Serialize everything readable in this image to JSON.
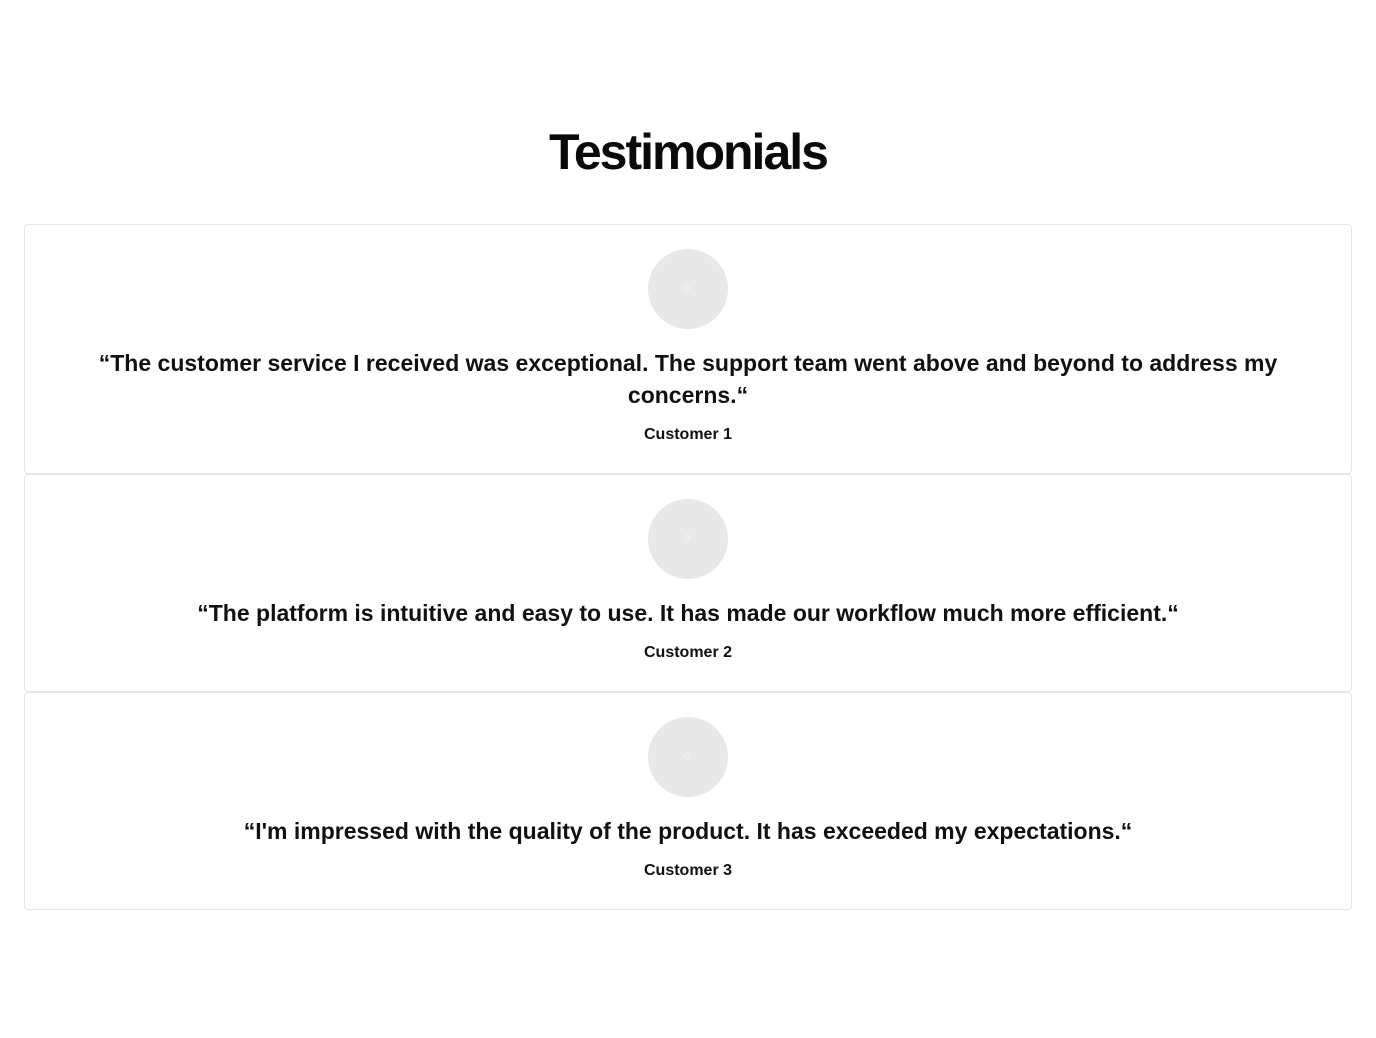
{
  "section": {
    "title": "Testimonials"
  },
  "testimonials": [
    {
      "quote": "“The customer service I received was exceptional. The support team went above and beyond to address my concerns.“",
      "author": "Customer 1"
    },
    {
      "quote": "“The platform is intuitive and easy to use. It has made our workflow much more efficient.“",
      "author": "Customer 2"
    },
    {
      "quote": "“I'm impressed with the quality of the product. It has exceeded my expectations.“",
      "author": "Customer 3"
    }
  ],
  "colors": {
    "background": "#ffffff",
    "text": "#111111",
    "card_border": "#e6e6e6",
    "avatar_placeholder": "#e8e8e8"
  }
}
